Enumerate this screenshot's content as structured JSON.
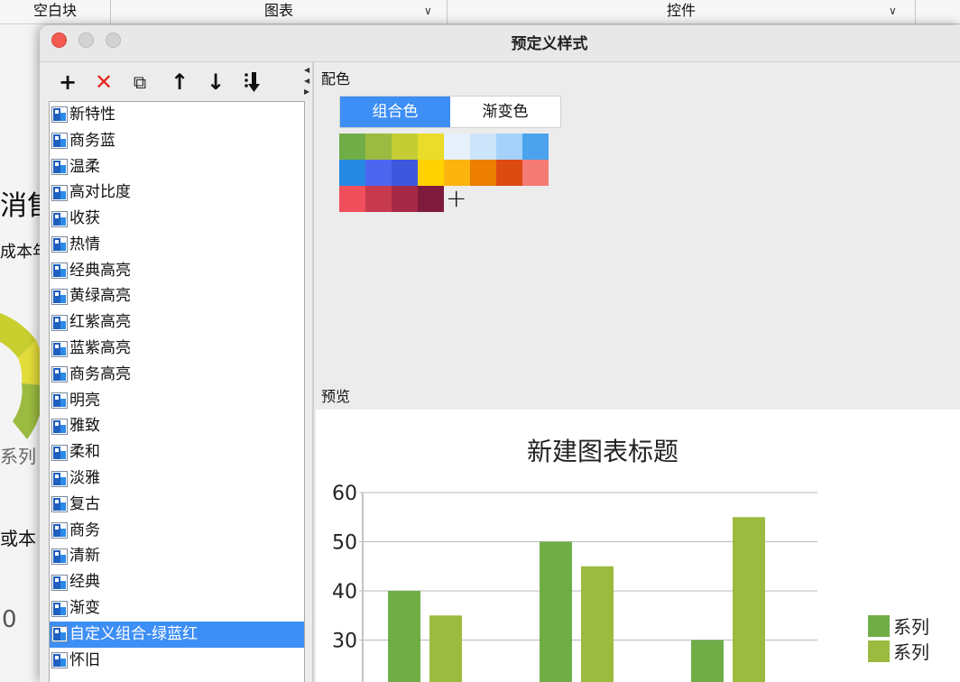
{
  "background_app": {
    "topbar_cells": [
      "空白块",
      "图表",
      "控件"
    ],
    "left_fragments": [
      "消售",
      "成本年",
      "系列",
      "或本",
      "0"
    ]
  },
  "dialog": {
    "title": "预定义样式",
    "toolbar": [
      {
        "icon": "plus-icon",
        "glyph": "+"
      },
      {
        "icon": "delete-x-icon",
        "glyph": "✕"
      },
      {
        "icon": "copy-icon",
        "glyph": "⧉"
      },
      {
        "icon": "arrow-up-icon",
        "glyph": "↑"
      },
      {
        "icon": "arrow-down-icon",
        "glyph": "↓"
      },
      {
        "icon": "sort-icon",
        "glyph": "⇩"
      }
    ],
    "styles": [
      "新特性",
      "商务蓝",
      "温柔",
      "高对比度",
      "收获",
      "热情",
      "经典高亮",
      "黄绿高亮",
      "红紫高亮",
      "蓝紫高亮",
      "商务高亮",
      "明亮",
      "雅致",
      "柔和",
      "淡雅",
      "复古",
      "商务",
      "清新",
      "经典",
      "渐变",
      "自定义组合-绿蓝红",
      "怀旧"
    ],
    "selected_style": "自定义组合-绿蓝红",
    "color_section_label": "配色",
    "tabs": [
      "组合色",
      "渐变色"
    ],
    "active_tab": "组合色",
    "colors": [
      "#70AD47",
      "#9BBB40",
      "#C5CD34",
      "#EADC2A",
      "#E6F1FB",
      "#CCE5FA",
      "#A4D2FA",
      "#4BA3EE",
      "#2588E2",
      "#4E66EF",
      "#3F57DC",
      "#FFD200",
      "#FCB40F",
      "#EC7E00",
      "#DD4B12",
      "#F47A76",
      "#F04E5B",
      "#C73A4E",
      "#A52A47",
      "#7E1B3D"
    ],
    "preview_label": "预览"
  },
  "chart_data": {
    "type": "bar",
    "title": "新建图表标题",
    "yticks": [
      30,
      40,
      50,
      60
    ],
    "ylim": [
      0,
      60
    ],
    "series": [
      {
        "name": "系列",
        "values": [
          40,
          50,
          30
        ],
        "color": "#70AD47"
      },
      {
        "name": "系列",
        "values": [
          35,
          45,
          55
        ],
        "color": "#9BBB40"
      }
    ],
    "legend_position": "right"
  }
}
